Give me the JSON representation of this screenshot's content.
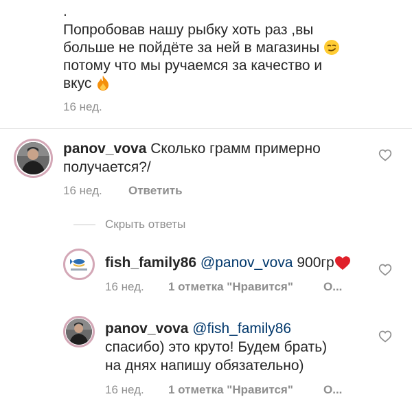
{
  "caption": {
    "dot": ".",
    "line1": "Попробовав нашу рыбку хоть раз ,вы",
    "line2": "больше не пойдёте за ней в магазины",
    "line3": "потому что мы ручаемся за качество и",
    "line4": "вкус",
    "emoji1": "smirk-emoji",
    "emoji2": "fire-emoji",
    "time": "16 нед."
  },
  "comment1": {
    "username": "panov_vova",
    "text_line1": "Сколько грамм примерно",
    "text_line2": "получается?/",
    "time": "16 нед.",
    "reply_label": "Ответить"
  },
  "hide_replies_label": "Скрыть ответы",
  "reply1": {
    "username": "fish_family86",
    "mention": "@panov_vova",
    "text": "900гр",
    "emoji": "red-heart-emoji",
    "time": "16 нед.",
    "likes": "1 отметка \"Нравится\"",
    "more": "О..."
  },
  "reply2": {
    "username": "panov_vova",
    "mention": "@fish_family86",
    "text_line1": "спасибо) это круто! Будем брать)",
    "text_line2": "на днях напишу обязательно)",
    "time": "16 нед.",
    "likes": "1 отметка \"Нравится\"",
    "more": "О..."
  },
  "colors": {
    "text": "#262626",
    "secondary": "#8e8e8e",
    "mention": "#00376b",
    "heart": "#e0202a"
  }
}
